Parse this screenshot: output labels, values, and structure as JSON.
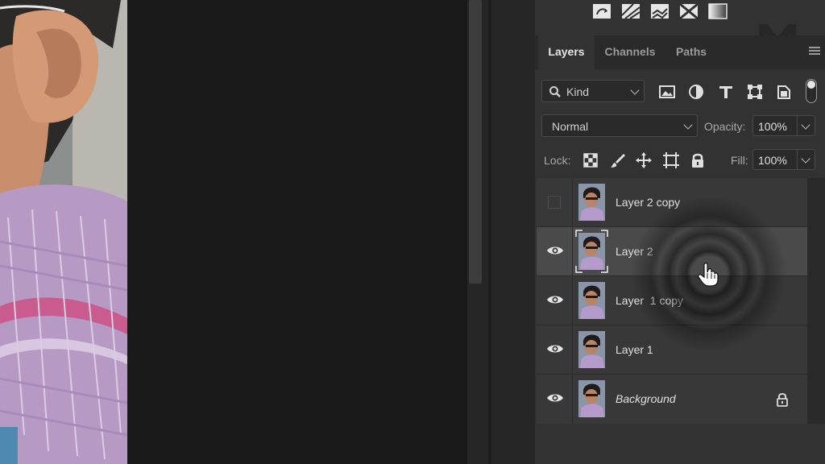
{
  "toolbar": {
    "icons": [
      "transform-rotate-icon",
      "warp-icon",
      "perspective-warp-icon",
      "flip-icon",
      "gradient-icon"
    ]
  },
  "panel": {
    "tabs": [
      {
        "label": "Layers",
        "active": true
      },
      {
        "label": "Channels",
        "active": false
      },
      {
        "label": "Paths",
        "active": false
      }
    ],
    "filter": {
      "label": "Kind"
    },
    "blend_mode": "Normal",
    "opacity_label": "Opacity:",
    "opacity_value": "100%",
    "lock_label": "Lock:",
    "fill_label": "Fill:",
    "fill_value": "100%"
  },
  "layers": [
    {
      "name": "Layer 2 copy",
      "visible": false,
      "selected": false,
      "locked": false,
      "italic": false
    },
    {
      "name": "Layer 2",
      "visible": true,
      "selected": true,
      "locked": false,
      "italic": false
    },
    {
      "name": "Layer  1 copy",
      "visible": true,
      "selected": false,
      "locked": false,
      "italic": false
    },
    {
      "name": "Layer 1",
      "visible": true,
      "selected": false,
      "locked": false,
      "italic": false
    },
    {
      "name": "Background",
      "visible": true,
      "selected": false,
      "locked": true,
      "italic": true
    }
  ],
  "colors": {
    "panel_bg": "#323232",
    "layer_row_bg": "#383838",
    "selected_row_bg": "#4a4a4a",
    "canvas_bg": "#191919"
  }
}
